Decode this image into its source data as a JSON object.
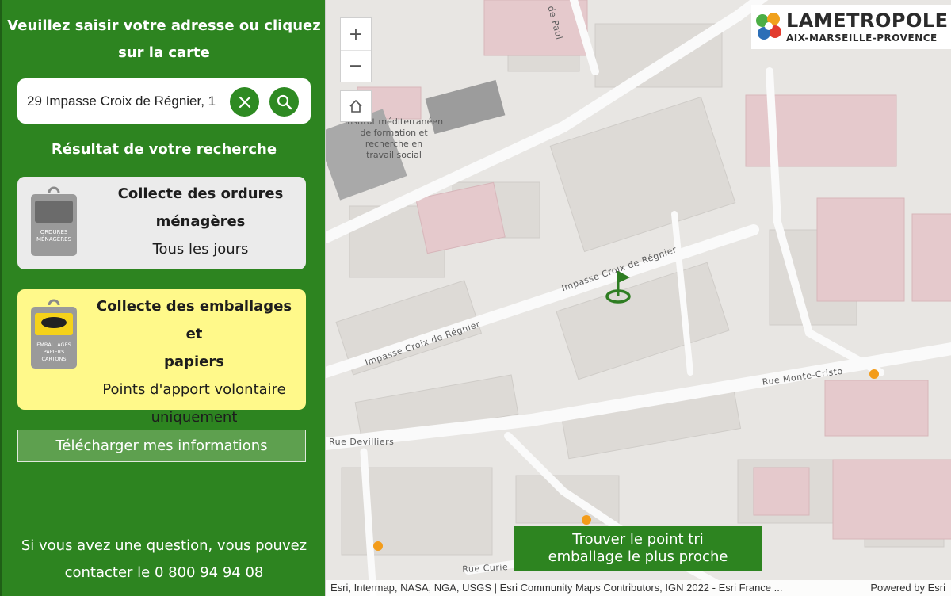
{
  "sidebar": {
    "title_line1": "Veuillez saisir votre adresse ou cliquez",
    "title_line2": "sur la carte",
    "search_value": "29 Impasse Croix de Régnier, 1",
    "result_title": "Résultat de votre recherche",
    "card_household": {
      "title_line1": "Collecte des ordures",
      "title_line2": "ménagères",
      "detail": "Tous les jours",
      "bin_label_1": "ORDURES",
      "bin_label_2": "MÉNAGÈRES",
      "color": "#ebebeb"
    },
    "card_packaging": {
      "title_line1": "Collecte des emballages et",
      "title_line2": "papiers",
      "detail_line1": "Points d'apport volontaire",
      "detail_line2": "uniquement",
      "bin_label_1": "EMBALLAGES",
      "bin_label_2": "PAPIERS",
      "bin_label_3": "CARTONS",
      "color": "#fff98a"
    },
    "download_label": "Télécharger mes informations",
    "contact_line1": "Si vous avez une question, vous pouvez",
    "contact_line2": "contacter le 0 800 94 94 08",
    "accent_color": "#2d8420"
  },
  "map": {
    "zoom_in": "+",
    "zoom_out": "−",
    "logo_word": "LAMETROPOLE",
    "logo_sub": "AIX-MARSEILLE-PROVENCE",
    "poi_line1": "Institut méditerranéen",
    "poi_line2": "de formation et",
    "poi_line3": "recherche en",
    "poi_line4": "travail social",
    "street_paul": "de Paul",
    "street_impasse_1": "Impasse Croix de Régnier",
    "street_impasse_2": "Impasse Croix de Régnier",
    "street_monte_cristo": "Rue Monte-Cristo",
    "street_devilliers": "Rue Devilliers",
    "street_curie": "Rue Curie",
    "find_line1": "Trouver le point tri",
    "find_line2": "emballage le plus proche",
    "attribution": "Esri, Intermap, NASA, NGA, USGS | Esri Community Maps Contributors, IGN 2022 - Esri France ...",
    "powered_by": "Powered by Esri",
    "marker_color": "#2e7d22",
    "collection_point_color": "#f39c1a"
  }
}
